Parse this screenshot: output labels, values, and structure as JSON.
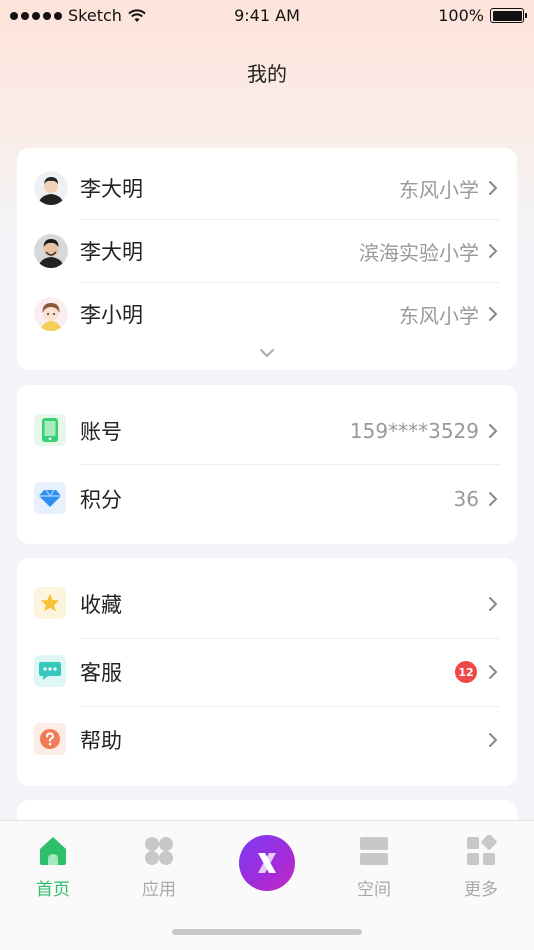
{
  "status_bar": {
    "carrier": "Sketch",
    "time": "9:41 AM",
    "battery": "100%"
  },
  "header": {
    "title": "我的"
  },
  "children": [
    {
      "name": "李大明",
      "school": "东风小学"
    },
    {
      "name": "李大明",
      "school": "滨海实验小学"
    },
    {
      "name": "李小明",
      "school": "东风小学"
    }
  ],
  "account": {
    "phone_label": "账号",
    "phone_value": "159****3529",
    "points_label": "积分",
    "points_value": "36"
  },
  "services": {
    "favorites_label": "收藏",
    "support_label": "客服",
    "support_badge": "12",
    "help_label": "帮助"
  },
  "tabbar": {
    "items": [
      {
        "label": "首页",
        "icon": "home-icon",
        "active": true
      },
      {
        "label": "应用",
        "icon": "apps-icon"
      },
      {
        "label": "",
        "icon": "x-logo-icon"
      },
      {
        "label": "空间",
        "icon": "space-icon"
      },
      {
        "label": "更多",
        "icon": "more-icon"
      }
    ]
  },
  "colors": {
    "accent": "#2dbf6a",
    "badge": "#ee4848",
    "center_button": "#8a35e6"
  }
}
